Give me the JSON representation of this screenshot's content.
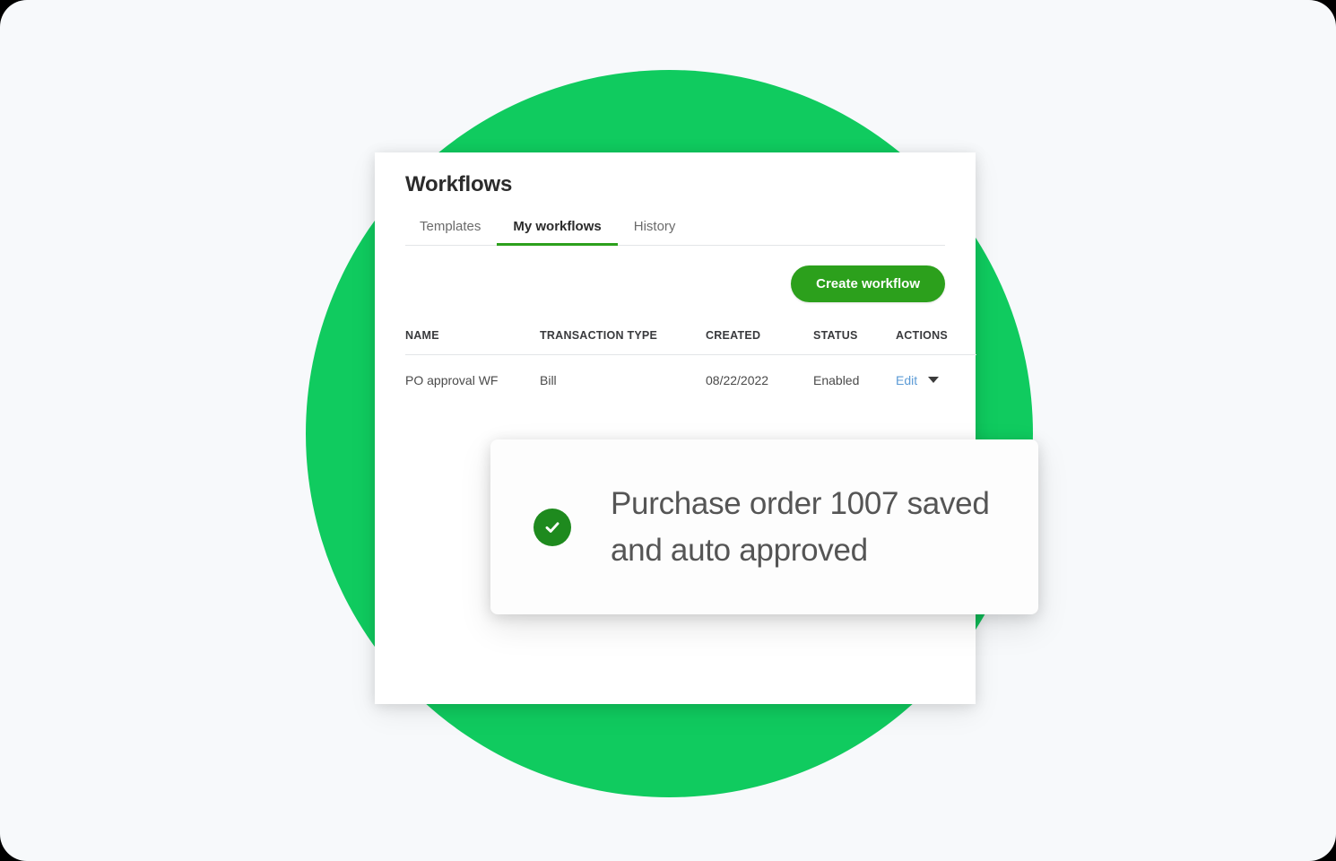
{
  "theme": {
    "canvas_bg": "#F7F9FB",
    "circle_green": "#10CB5F",
    "brand_green": "#2CA01C",
    "toast_icon_green": "#1E8A1E",
    "link_blue": "#5C9BD6",
    "text_dark": "#2B2B2B",
    "text_muted": "#6B6B6B"
  },
  "decor": {
    "circle_name": "green-circle-backdrop"
  },
  "card": {
    "title": "Workflows",
    "tabs": [
      {
        "id": "templates",
        "label": "Templates",
        "active": false
      },
      {
        "id": "my-workflows",
        "label": "My workflows",
        "active": true
      },
      {
        "id": "history",
        "label": "History",
        "active": false
      }
    ],
    "create_button": {
      "label": "Create workflow",
      "icon": "plus-icon"
    },
    "table": {
      "columns": [
        "NAME",
        "TRANSACTION TYPE",
        "CREATED",
        "STATUS",
        "ACTIONS"
      ],
      "rows": [
        {
          "name": "PO approval WF",
          "transaction_type": "Bill",
          "created": "08/22/2022",
          "status": "Enabled",
          "action_label": "Edit",
          "action_caret": "chevron-down-icon"
        }
      ]
    }
  },
  "toast": {
    "icon": "check-circle-icon",
    "message": "Purchase order 1007 saved and auto approved",
    "message_line_1": "Purchase order 1007",
    "message_line_2": "saved and auto approved"
  }
}
